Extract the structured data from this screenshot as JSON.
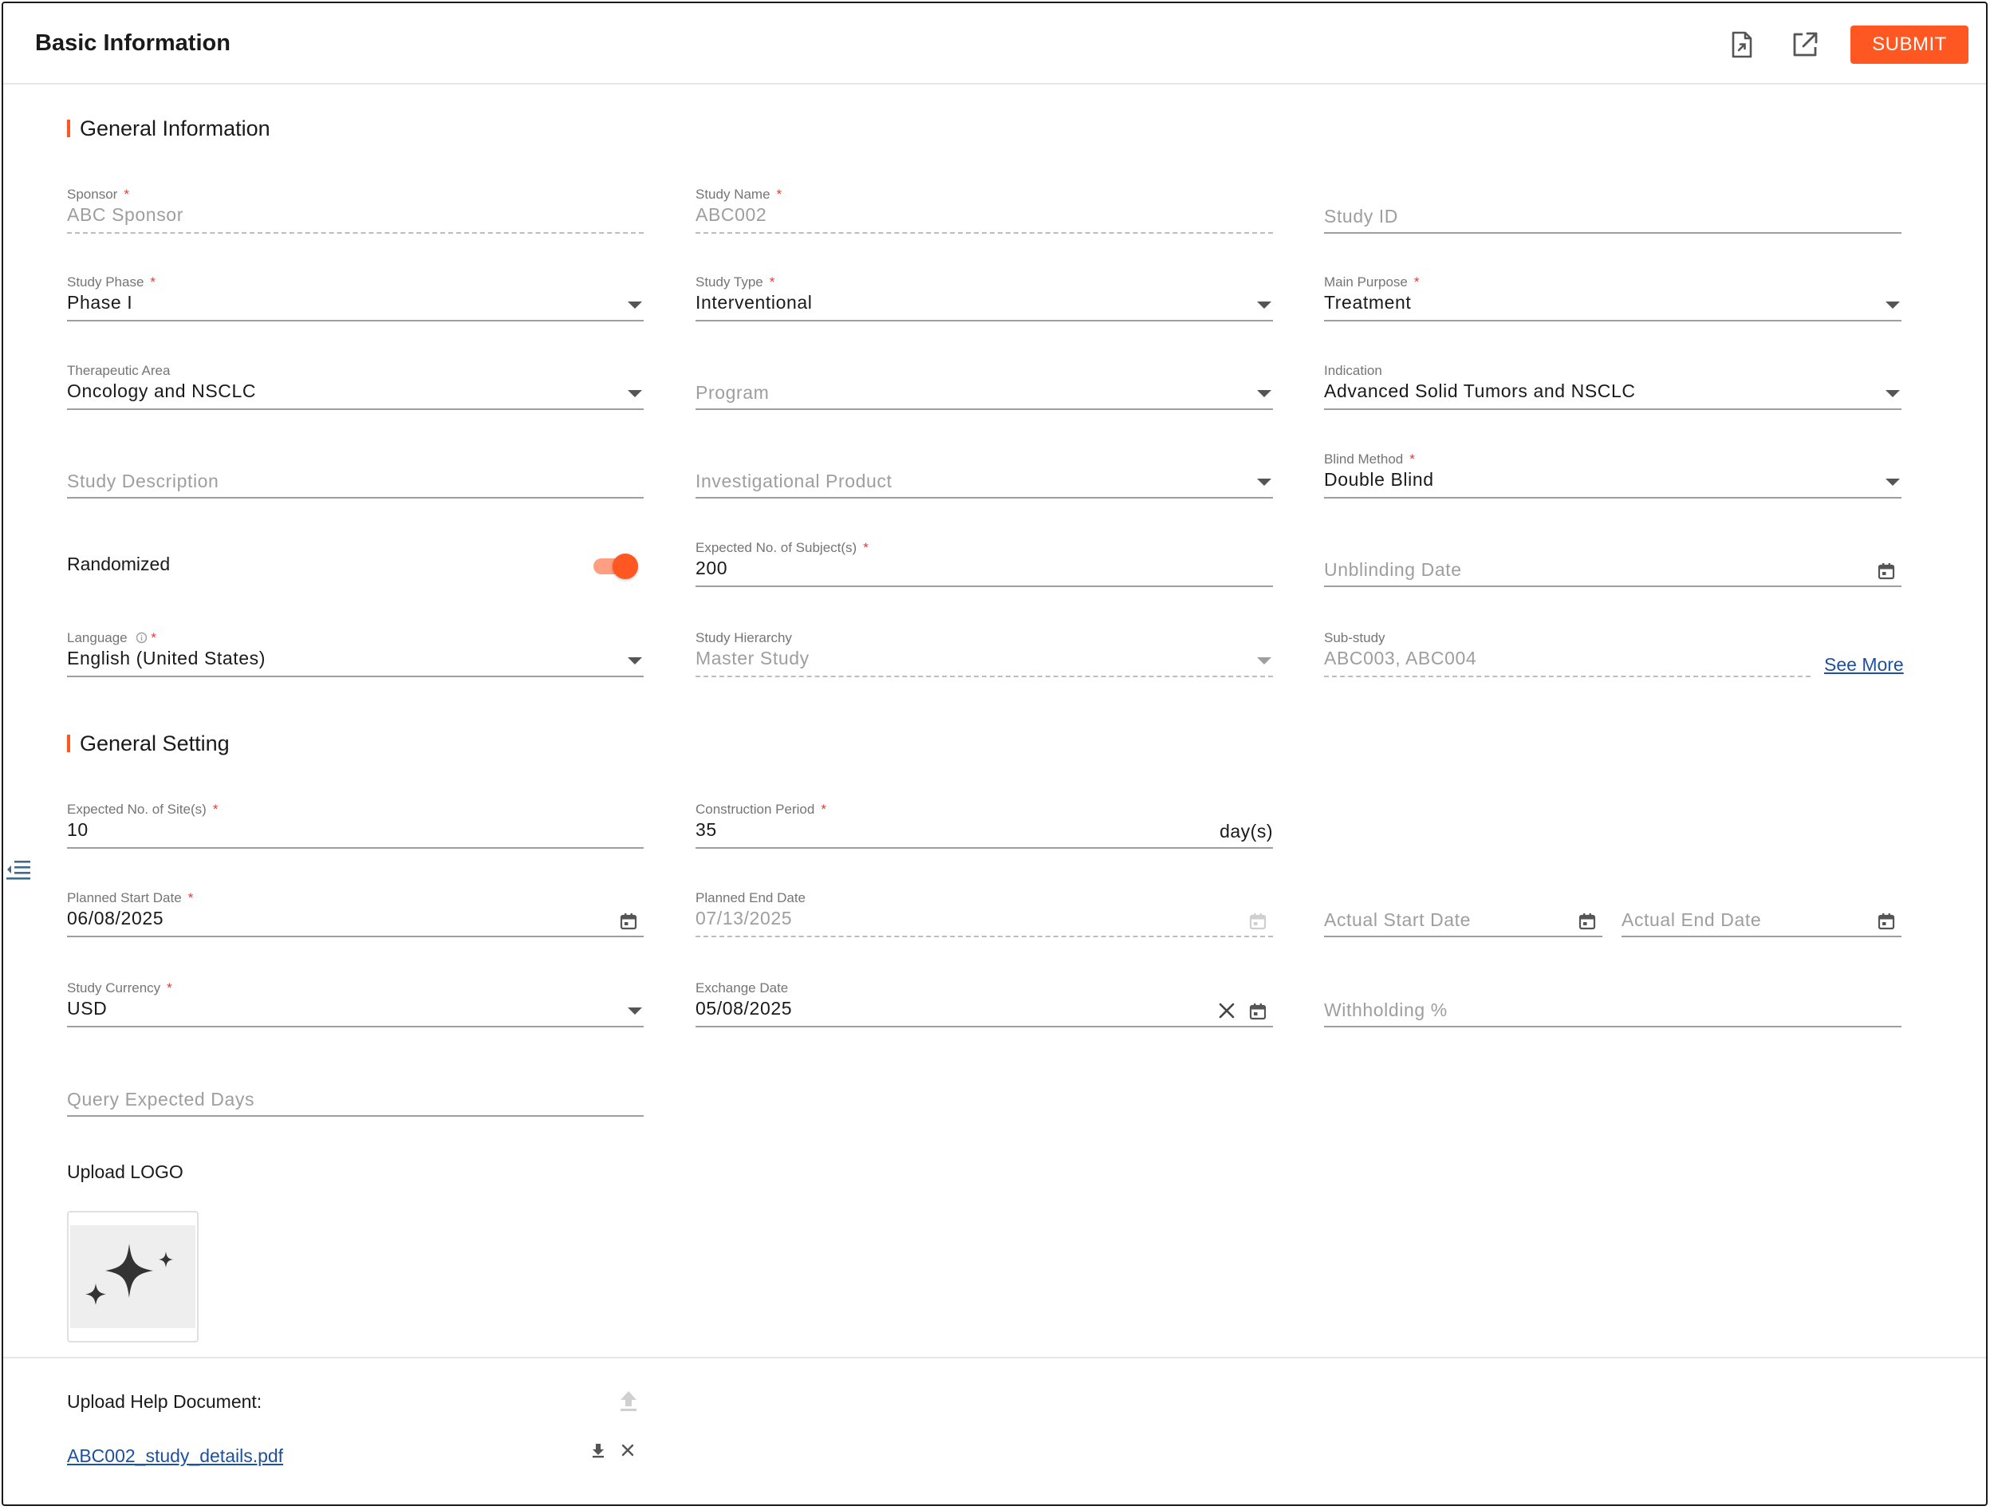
{
  "header": {
    "title": "Basic Information",
    "export_icon": "file-export-icon",
    "open_icon": "open-in-new-icon",
    "submit_label": "SUBMIT",
    "accent_color": "#ff5722"
  },
  "sections": {
    "general_information": "General Information",
    "general_setting": "General Setting"
  },
  "fields": {
    "sponsor": {
      "label": "Sponsor",
      "value": "ABC Sponsor"
    },
    "study_name": {
      "label": "Study Name",
      "value": "ABC002"
    },
    "study_id": {
      "placeholder": "Study ID"
    },
    "study_phase": {
      "label": "Study Phase",
      "value": "Phase I"
    },
    "study_type": {
      "label": "Study Type",
      "value": "Interventional"
    },
    "main_purpose": {
      "label": "Main Purpose",
      "value": "Treatment"
    },
    "therapeutic_area": {
      "label": "Therapeutic Area",
      "value": "Oncology and NSCLC"
    },
    "program": {
      "placeholder": "Program"
    },
    "indication": {
      "label": "Indication",
      "value": "Advanced Solid Tumors and NSCLC"
    },
    "study_description": {
      "placeholder": "Study Description"
    },
    "investigational_product": {
      "placeholder": "Investigational Product"
    },
    "blind_method": {
      "label": "Blind Method",
      "value": "Double Blind"
    },
    "randomized": {
      "label": "Randomized",
      "checked": true
    },
    "expected_subjects": {
      "label": "Expected No. of Subject(s)",
      "value": "200"
    },
    "unblinding_date": {
      "placeholder": "Unblinding Date"
    },
    "language": {
      "label": "Language",
      "value": "English (United States)",
      "info_icon": "info-icon"
    },
    "study_hierarchy": {
      "label": "Study Hierarchy",
      "value": "Master Study"
    },
    "sub_study": {
      "label": "Sub-study",
      "value": "ABC003, ABC004",
      "see_more": "See More"
    },
    "expected_sites": {
      "label": "Expected No. of Site(s)",
      "value": "10"
    },
    "construction_period": {
      "label": "Construction Period",
      "value": "35",
      "suffix": "day(s)"
    },
    "planned_start_date": {
      "label": "Planned Start Date",
      "value": "06/08/2025"
    },
    "planned_end_date": {
      "label": "Planned End Date",
      "value": "07/13/2025"
    },
    "actual_start_date": {
      "placeholder": "Actual Start Date"
    },
    "actual_end_date": {
      "placeholder": "Actual End Date"
    },
    "study_currency": {
      "label": "Study Currency",
      "value": "USD"
    },
    "exchange_date": {
      "label": "Exchange Date",
      "value": "05/08/2025"
    },
    "withholding": {
      "placeholder": "Withholding %"
    },
    "query_expected_days": {
      "placeholder": "Query Expected Days"
    }
  },
  "upload": {
    "logo_label": "Upload LOGO",
    "logo_icon": "sparkles-icon",
    "help_label": "Upload Help Document:",
    "help_file": "ABC002_study_details.pdf"
  }
}
